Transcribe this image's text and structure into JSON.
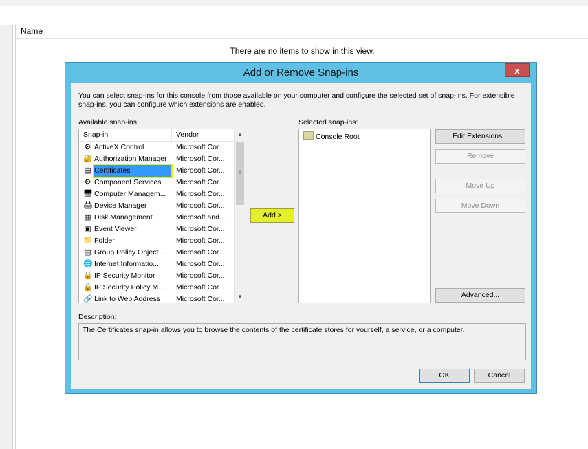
{
  "background": {
    "column_header": "Name",
    "empty_message": "There are no items to show in this view."
  },
  "dialog": {
    "title": "Add or Remove Snap-ins",
    "close_glyph": "x",
    "intro": "You can select snap-ins for this console from those available on your computer and configure the selected set of snap-ins. For extensible snap-ins, you can configure which extensions are enabled.",
    "available_label": "Available snap-ins:",
    "selected_label": "Selected snap-ins:",
    "columns": {
      "snapin": "Snap-in",
      "vendor": "Vendor"
    },
    "available_snapins": [
      {
        "name": "ActiveX Control",
        "vendor": "Microsoft Cor...",
        "icon": "activex-icon"
      },
      {
        "name": "Authorization Manager",
        "vendor": "Microsoft Cor...",
        "icon": "authorization-icon"
      },
      {
        "name": "Certificates",
        "vendor": "Microsoft Cor...",
        "icon": "certificates-icon",
        "selected": true
      },
      {
        "name": "Component Services",
        "vendor": "Microsoft Cor...",
        "icon": "component-services-icon"
      },
      {
        "name": "Computer Managem...",
        "vendor": "Microsoft Cor...",
        "icon": "computer-management-icon"
      },
      {
        "name": "Device Manager",
        "vendor": "Microsoft Cor...",
        "icon": "device-manager-icon"
      },
      {
        "name": "Disk Management",
        "vendor": "Microsoft and...",
        "icon": "disk-management-icon"
      },
      {
        "name": "Event Viewer",
        "vendor": "Microsoft Cor...",
        "icon": "event-viewer-icon"
      },
      {
        "name": "Folder",
        "vendor": "Microsoft Cor...",
        "icon": "folder-icon"
      },
      {
        "name": "Group Policy Object ...",
        "vendor": "Microsoft Cor...",
        "icon": "group-policy-icon"
      },
      {
        "name": "Internet Informatio...",
        "vendor": "Microsoft Cor...",
        "icon": "iis-icon"
      },
      {
        "name": "IP Security Monitor",
        "vendor": "Microsoft Cor...",
        "icon": "ip-security-icon"
      },
      {
        "name": "IP Security Policy M...",
        "vendor": "Microsoft Cor...",
        "icon": "ip-security-icon"
      },
      {
        "name": "Link to Web Address",
        "vendor": "Microsoft Cor...",
        "icon": "link-icon"
      }
    ],
    "selected_snapins": [
      {
        "name": "Console Root",
        "icon": "folder-icon"
      }
    ],
    "buttons": {
      "add": "Add >",
      "edit_extensions": "Edit Extensions...",
      "remove": "Remove",
      "move_up": "Move Up",
      "move_down": "Move Down",
      "advanced": "Advanced...",
      "ok": "OK",
      "cancel": "Cancel"
    },
    "description_label": "Description:",
    "description_text": "The Certificates snap-in allows you to browse the contents of the certificate stores for yourself, a service, or a computer."
  },
  "colors": {
    "dialog_frame": "#5fbfe4",
    "close_button": "#c75050",
    "highlight": "#e5ef2e",
    "selection": "#3399ff"
  }
}
